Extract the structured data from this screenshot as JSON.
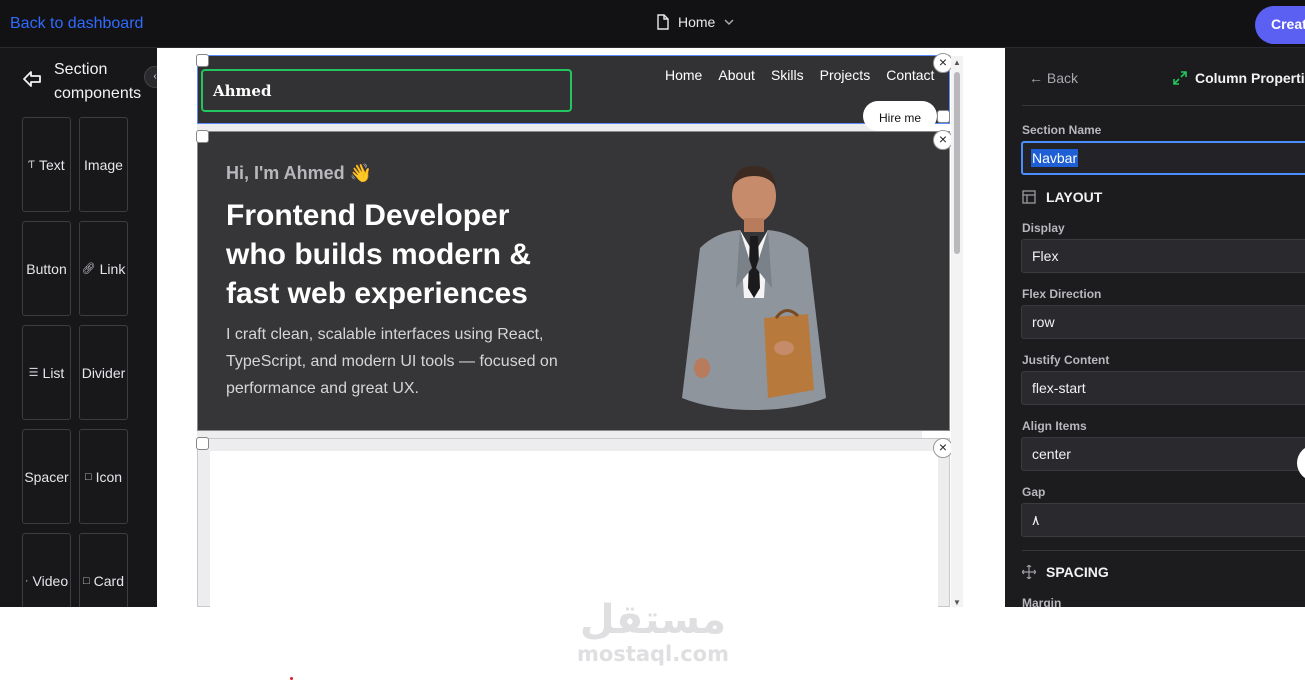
{
  "topbar": {
    "back_label": "Back to dashboard",
    "page_name": "Home",
    "create_label": "Creat"
  },
  "left_panel": {
    "title_line1": "Section",
    "title_line2": "components",
    "components": [
      {
        "label": "Text",
        "icon": "text-icon"
      },
      {
        "label": "Image",
        "icon": ""
      },
      {
        "label": "Button",
        "icon": ""
      },
      {
        "label": "Link",
        "icon": "link-icon"
      },
      {
        "label": "List",
        "icon": "list-icon"
      },
      {
        "label": "Divider",
        "icon": ""
      },
      {
        "label": "Spacer",
        "icon": ""
      },
      {
        "label": "Icon",
        "icon": "square-icon"
      },
      {
        "label": "Video",
        "icon": "dot-icon"
      },
      {
        "label": "Card",
        "icon": "square-icon"
      }
    ]
  },
  "preview": {
    "logo": "Ahmed",
    "nav_links": [
      "Home",
      "About",
      "Skills",
      "Projects",
      "Contact"
    ],
    "hire_label": "Hire me",
    "greeting": "Hi, I'm Ahmed 👋",
    "headline": "Frontend Developer who builds modern & fast web experiences",
    "description": "I craft clean, scalable interfaces using React, TypeScript, and modern UI tools — focused on performance and great UX.",
    "close_symbol": "×"
  },
  "right_panel": {
    "back_label": "← Back",
    "title": "Column Propertie",
    "section_name_label": "Section Name",
    "section_name_value": "Navbar",
    "layout_heading": "LAYOUT",
    "display_label": "Display",
    "display_value": "Flex",
    "flex_direction_label": "Flex Direction",
    "flex_direction_value": "row",
    "justify_label": "Justify Content",
    "justify_value": "flex-start",
    "align_label": "Align Items",
    "align_value": "center",
    "gap_label": "Gap",
    "gap_value": "٨",
    "spacing_heading": "SPACING",
    "margin_label": "Margin"
  },
  "watermark": {
    "arabic": "مستقل",
    "latin": "mostaql.com"
  },
  "colors": {
    "accent": "#5b60f2",
    "link": "#2f6bff",
    "selection_outline": "#22c55e",
    "icon_green": "#22c55e"
  }
}
